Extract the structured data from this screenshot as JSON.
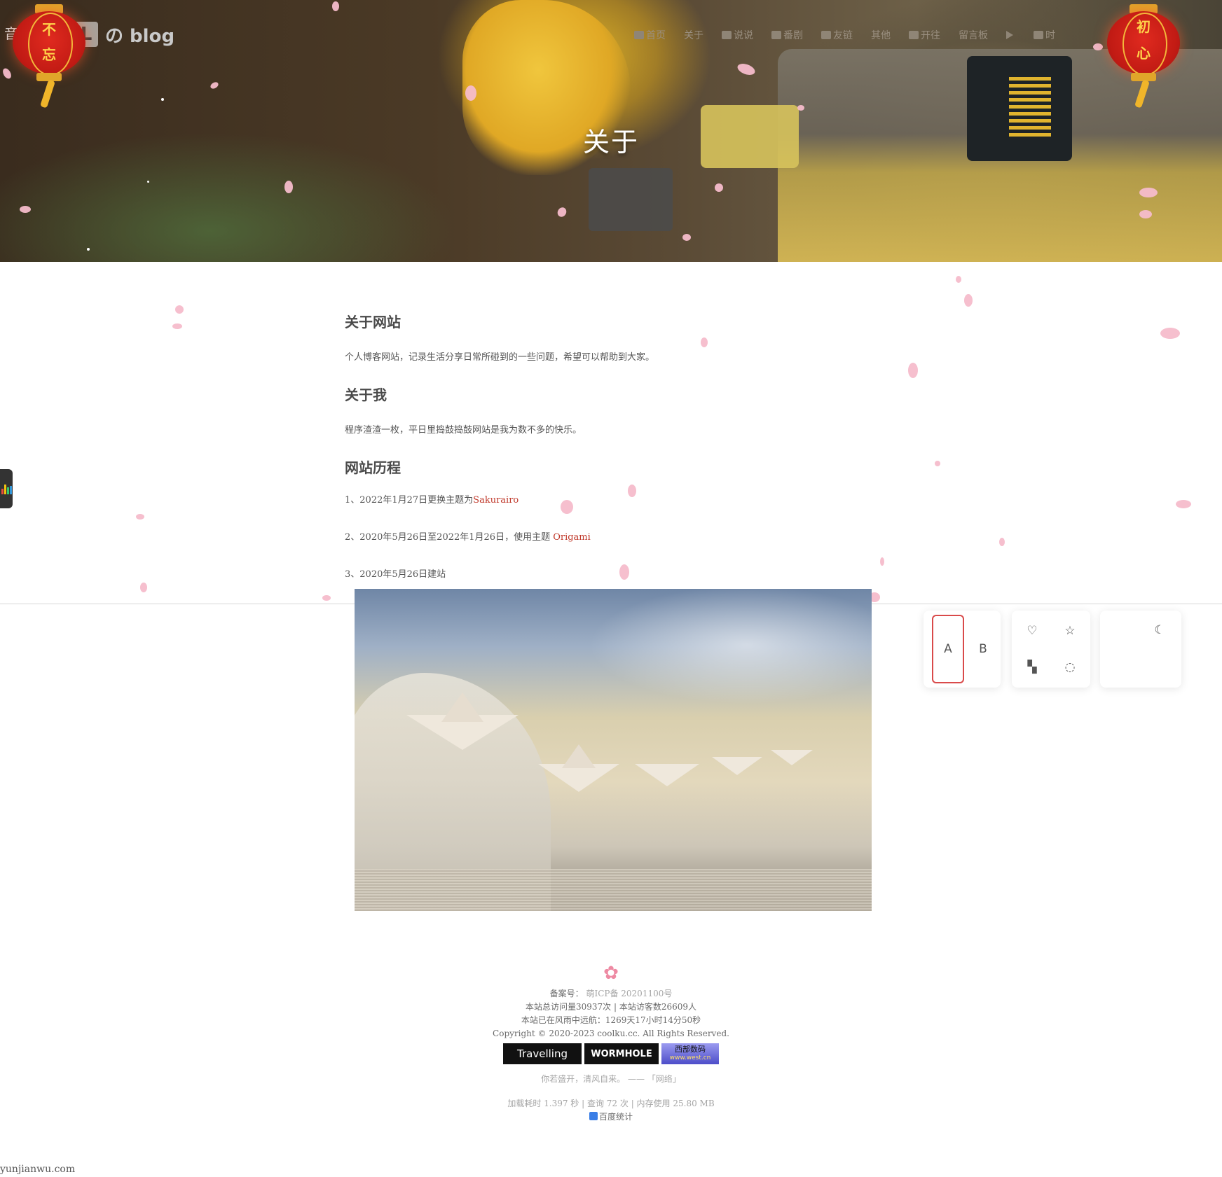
{
  "brand": {
    "volume_label": "音量：90%",
    "logo_letter": "L",
    "logo_text": "の blog"
  },
  "nav": {
    "items": [
      {
        "label": "首页",
        "icon": "home-icon"
      },
      {
        "label": "关于",
        "icon": ""
      },
      {
        "label": "说说",
        "icon": "comment-icon"
      },
      {
        "label": "番剧",
        "icon": "film-icon"
      },
      {
        "label": "友链",
        "icon": "link-icon"
      },
      {
        "label": "其他",
        "icon": ""
      },
      {
        "label": "开往",
        "icon": "train-icon"
      },
      {
        "label": "留言板",
        "icon": ""
      },
      {
        "label": "",
        "icon": "play-icon"
      },
      {
        "label": "时",
        "icon": "calendar-icon"
      }
    ]
  },
  "lanterns": {
    "left": [
      "不",
      "忘"
    ],
    "right": [
      "初",
      "心"
    ]
  },
  "hero": {
    "title": "关于"
  },
  "article": {
    "sections": [
      {
        "heading": "关于网站",
        "text": "个人博客网站，记录生活分享日常所碰到的一些问题，希望可以帮助到大家。"
      },
      {
        "heading": "关于我",
        "text": "程序渣渣一枚，平日里捣鼓捣鼓网站是我为数不多的快乐。"
      },
      {
        "heading": "网站历程"
      }
    ],
    "history": [
      {
        "text": "1、2022年1月27日更换主题为",
        "link": "Sakurairo"
      },
      {
        "text": "2、2020年5月26日至2022年1月26日，使用主题 ",
        "link": "Origami"
      },
      {
        "text": "3、2020年5月26日建站",
        "link": ""
      }
    ]
  },
  "widget": {
    "font_options": [
      "A",
      "B"
    ],
    "selected_font": "A",
    "icons": [
      "heart-icon",
      "star-icon",
      "checker-icon",
      "leaf-icon",
      "moon-icon"
    ]
  },
  "footer": {
    "icp_prefix": "备案号：",
    "icp_number": "萌ICP备 20201100号",
    "visits": "本站总访问量30937次 | 本站访客数26609人",
    "uptime": "本站已在风雨中远航：1269天17小时14分50秒",
    "copyright": "Copyright © 2020-2023 coolku.cc. All Rights Reserved.",
    "badges": [
      "Travelling",
      "WORMHOLE",
      "西部数码"
    ],
    "badge_sub": "www.west.cn",
    "quote": "你若盛开，清风自来。 —— 「网络」",
    "load_stats": "加载耗时 1.397 秒 | 查询 72 次 | 内存使用 25.80 MB",
    "baidu": "百度统计"
  },
  "watermark": "yunjianwu.com",
  "colors": {
    "link": "#c0392b",
    "petal": "#f6bccb",
    "lantern_red": "#c21b14",
    "lantern_gold": "#ffd24a",
    "active_border": "#d94a4a"
  }
}
